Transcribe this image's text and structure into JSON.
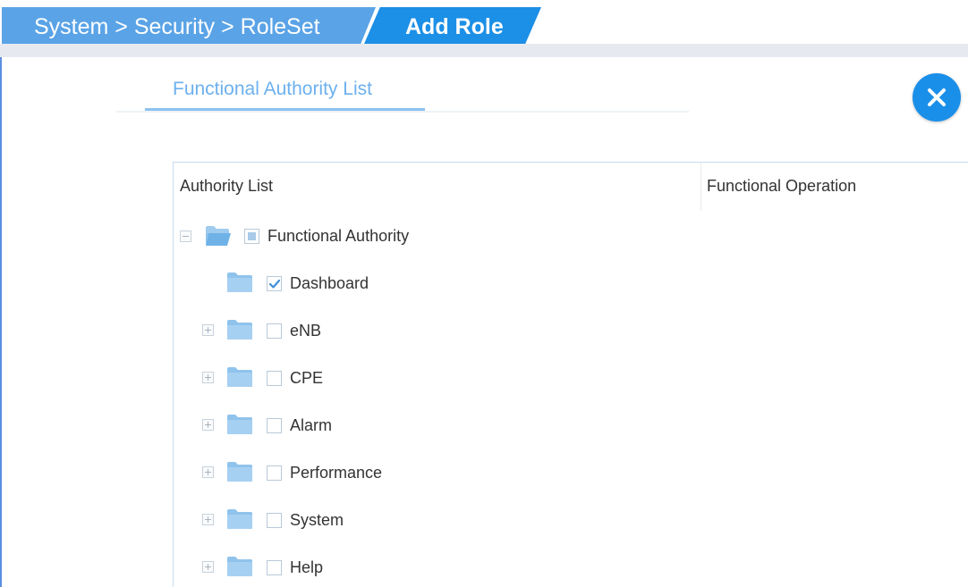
{
  "breadcrumb": {
    "path": "System > Security > RoleSet",
    "current": "Add Role"
  },
  "section": {
    "title": "Functional Authority List"
  },
  "table": {
    "col_authority": "Authority List",
    "col_operation": "Functional Operation"
  },
  "tree": {
    "root": {
      "label": "Functional Authority",
      "state": "partial",
      "expanded": true
    },
    "items": [
      {
        "label": "Dashboard",
        "checked": true,
        "has_children": false
      },
      {
        "label": "eNB",
        "checked": false,
        "has_children": true
      },
      {
        "label": "CPE",
        "checked": false,
        "has_children": true
      },
      {
        "label": "Alarm",
        "checked": false,
        "has_children": true
      },
      {
        "label": "Performance",
        "checked": false,
        "has_children": true
      },
      {
        "label": "System",
        "checked": false,
        "has_children": true
      },
      {
        "label": "Help",
        "checked": false,
        "has_children": true
      }
    ]
  },
  "colors": {
    "accent": "#1a8fe9",
    "breadcrumb": "#5aa3e6",
    "folder": "#8fc3ec",
    "title": "#6cb0ee"
  },
  "icons": {
    "close": "close-icon",
    "folder": "folder-icon",
    "expand": "plus-icon",
    "collapse": "minus-icon"
  }
}
